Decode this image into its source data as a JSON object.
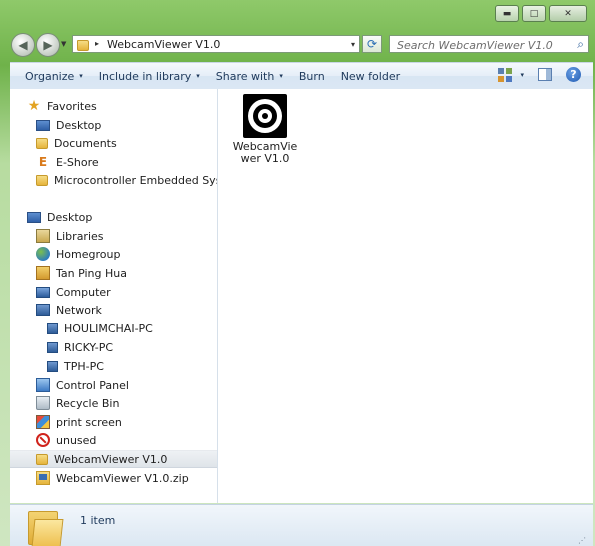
{
  "window": {
    "caption_buttons": {
      "minimize": "▬",
      "maximize": "□",
      "close": "✕"
    }
  },
  "address": {
    "path": "WebcamViewer V1.0",
    "separator": "▸",
    "dropdown": "▾"
  },
  "search": {
    "placeholder": "Search WebcamViewer V1.0",
    "icon": "search-icon"
  },
  "toolbar": {
    "items": [
      {
        "label": "Organize",
        "caret": "▾"
      },
      {
        "label": "Include in library",
        "caret": "▾"
      },
      {
        "label": "Share with",
        "caret": "▾"
      },
      {
        "label": "Burn"
      },
      {
        "label": "New folder"
      }
    ],
    "view_caret": "▾",
    "help": "?"
  },
  "nav": {
    "items": [
      {
        "label": "Favorites",
        "icon": "star-icon"
      },
      {
        "label": "Desktop",
        "icon": "monitor-icon"
      },
      {
        "label": "Documents",
        "icon": "folder-icon"
      },
      {
        "label": "E-Shore",
        "icon": "eshore-icon"
      },
      {
        "label": "Microcontroller Embedded System",
        "icon": "folder-icon"
      },
      {
        "label": "Desktop",
        "icon": "monitor-icon"
      },
      {
        "label": "Libraries",
        "icon": "libraries-icon"
      },
      {
        "label": "Homegroup",
        "icon": "homegroup-icon"
      },
      {
        "label": "Tan Ping Hua",
        "icon": "user-folder-icon"
      },
      {
        "label": "Computer",
        "icon": "computer-icon"
      },
      {
        "label": "Network",
        "icon": "network-icon"
      },
      {
        "label": "HOULIMCHAI-PC",
        "icon": "pc-icon"
      },
      {
        "label": "RICKY-PC",
        "icon": "pc-icon"
      },
      {
        "label": "TPH-PC",
        "icon": "pc-icon"
      },
      {
        "label": "Control Panel",
        "icon": "control-panel-icon"
      },
      {
        "label": "Recycle Bin",
        "icon": "recycle-bin-icon"
      },
      {
        "label": "print screen",
        "icon": "paint-icon"
      },
      {
        "label": "unused",
        "icon": "forbidden-icon"
      },
      {
        "label": "WebcamViewer V1.0",
        "icon": "folder-icon",
        "selected": true
      },
      {
        "label": "WebcamViewer V1.0.zip",
        "icon": "zip-folder-icon"
      }
    ]
  },
  "content": {
    "files": [
      {
        "name": "WebcamViewer V1.0",
        "icon": "webcam-icon"
      }
    ]
  },
  "status": {
    "count": "1 item",
    "grip": "⋰"
  }
}
